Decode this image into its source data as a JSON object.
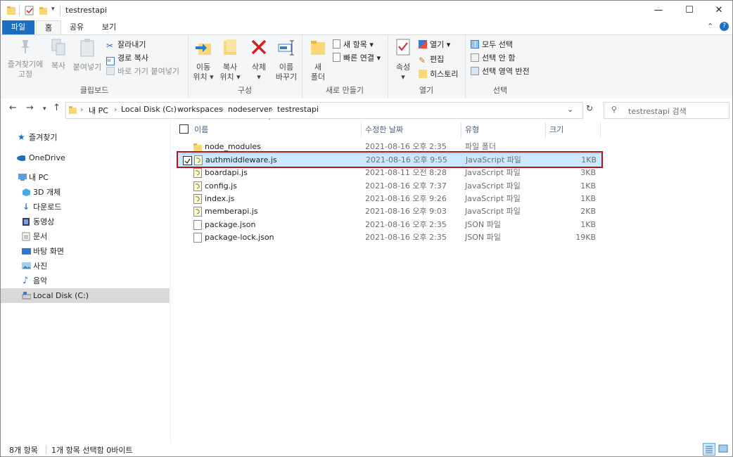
{
  "window": {
    "title": "testrestapi",
    "minimize": "—",
    "maximize": "☐",
    "close": "✕"
  },
  "tabs": [
    "파일",
    "홈",
    "공유",
    "보기"
  ],
  "ribbon": {
    "clipboard": {
      "label": "클립보드",
      "pin": [
        "즐겨찾기에",
        "고정"
      ],
      "copy": "복사",
      "paste": "붙여넣기",
      "cut": "잘라내기",
      "copy_path": "경로 복사",
      "paste_shortcut": "바로 가기 붙여넣기"
    },
    "organize": {
      "label": "구성",
      "move": [
        "이동",
        "위치 ▾"
      ],
      "copyto": [
        "복사",
        "위치 ▾"
      ],
      "delete": [
        "삭제",
        "▾"
      ],
      "rename": [
        "이름",
        "바꾸기"
      ]
    },
    "new": {
      "label": "새로 만들기",
      "folder": [
        "새",
        "폴더"
      ],
      "item": "새 항목 ▾",
      "easy": "빠른 연결 ▾"
    },
    "open": {
      "label": "열기",
      "props": [
        "속성",
        "▾"
      ],
      "open": "열기 ▾",
      "edit": "편집",
      "history": "히스토리"
    },
    "select": {
      "label": "선택",
      "all": "모두 선택",
      "none": "선택 안 함",
      "invert": "선택 영역 반전"
    }
  },
  "address": {
    "crumbs": [
      "내 PC",
      "Local Disk (C:)",
      "workspaces",
      "nodeserver",
      "testrestapi"
    ],
    "search_placeholder": "testrestapi 검색"
  },
  "nav": {
    "quick": "즐겨찾기",
    "onedrive": "OneDrive",
    "pc": "내 PC",
    "objects3d": "3D 개체",
    "downloads": "다운로드",
    "videos": "동영상",
    "docs": "문서",
    "desktop": "바탕 화면",
    "pictures": "사진",
    "music": "음악",
    "localdisk": "Local Disk (C:)"
  },
  "columns": {
    "name": "이름",
    "date": "수정한 날짜",
    "type": "유형",
    "size": "크기"
  },
  "files": [
    {
      "name": "node_modules",
      "date": "2021-08-16 오후 2:35",
      "type": "파일 폴더",
      "size": ""
    },
    {
      "name": "authmiddleware.js",
      "date": "2021-08-16 오후 9:55",
      "type": "JavaScript 파일",
      "size": "1KB"
    },
    {
      "name": "boardapi.js",
      "date": "2021-08-11 오전 8:28",
      "type": "JavaScript 파일",
      "size": "3KB"
    },
    {
      "name": "config.js",
      "date": "2021-08-16 오후 7:37",
      "type": "JavaScript 파일",
      "size": "1KB"
    },
    {
      "name": "index.js",
      "date": "2021-08-16 오후 9:26",
      "type": "JavaScript 파일",
      "size": "1KB"
    },
    {
      "name": "memberapi.js",
      "date": "2021-08-16 오후 9:03",
      "type": "JavaScript 파일",
      "size": "2KB"
    },
    {
      "name": "package.json",
      "date": "2021-08-16 오후 2:35",
      "type": "JSON 파일",
      "size": "1KB"
    },
    {
      "name": "package-lock.json",
      "date": "2021-08-16 오후 2:35",
      "type": "JSON 파일",
      "size": "19KB"
    }
  ],
  "status": {
    "count": "8개 항목",
    "selected": "1개 항목 선택함 0바이트"
  },
  "colors": {
    "accent": "#1a6fc5",
    "selection": "#cce8ff",
    "highlight_box": "#b5121b"
  }
}
